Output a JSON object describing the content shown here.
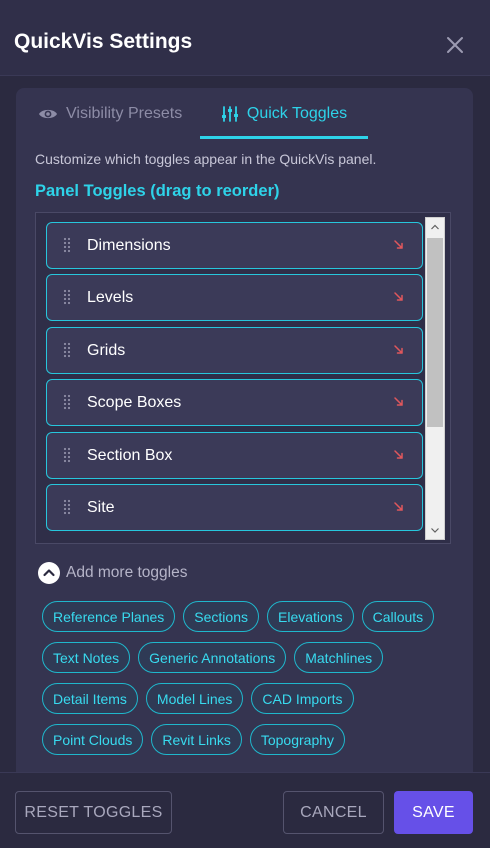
{
  "dialog": {
    "title": "QuickVis Settings"
  },
  "tabs": [
    {
      "label": "Visibility Presets",
      "icon": "eye-icon",
      "active": false
    },
    {
      "label": "Quick Toggles",
      "icon": "sliders-icon",
      "active": true
    }
  ],
  "content": {
    "description": "Customize which toggles appear in the QuickVis panel.",
    "section_title": "Panel Toggles (drag to reorder)",
    "panel_toggles": [
      "Dimensions",
      "Levels",
      "Grids",
      "Scope Boxes",
      "Section Box",
      "Site"
    ],
    "add_more_label": "Add more toggles",
    "available_toggles": [
      [
        "Reference Planes",
        "Sections",
        "Elevations",
        "Callouts"
      ],
      [
        "Text Notes",
        "Generic Annotations",
        "Matchlines"
      ],
      [
        "Detail Items",
        "Model Lines",
        "CAD Imports"
      ],
      [
        "Point Clouds",
        "Revit Links",
        "Topography"
      ]
    ]
  },
  "footer": {
    "reset_label": "RESET TOGGLES",
    "cancel_label": "CANCEL",
    "save_label": "SAVE"
  },
  "colors": {
    "accent": "#2ed3e9",
    "primary_button": "#6650e8",
    "remove_icon": "#e0575c",
    "background": "#2b2a40"
  }
}
